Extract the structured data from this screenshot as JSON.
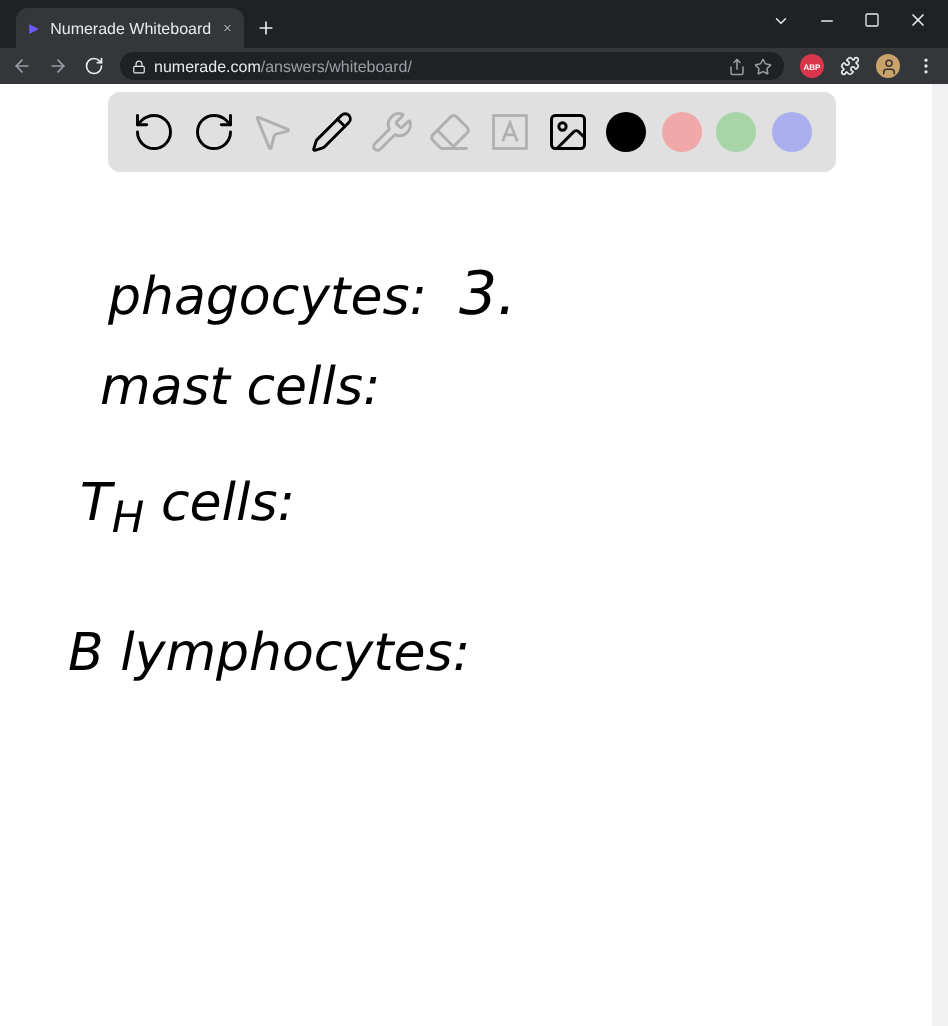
{
  "browser": {
    "tab": {
      "title": "Numerade Whiteboard",
      "selected": true
    },
    "address": {
      "domain": "numerade.com",
      "path": "/answers/whiteboard/"
    },
    "extension_badge": "ABP"
  },
  "toolbar": {
    "tools": [
      {
        "kind": "undo",
        "disabled": false
      },
      {
        "kind": "redo",
        "disabled": false
      },
      {
        "kind": "select",
        "disabled": true
      },
      {
        "kind": "pen",
        "disabled": false
      },
      {
        "kind": "shapes",
        "disabled": true
      },
      {
        "kind": "eraser",
        "disabled": true
      },
      {
        "kind": "text",
        "disabled": true
      },
      {
        "kind": "image",
        "disabled": false
      }
    ],
    "colors": [
      {
        "color": "#000000"
      },
      {
        "color": "#f0a8a8"
      },
      {
        "color": "#a8d4a8"
      },
      {
        "color": "#aab0ee"
      }
    ]
  },
  "whiteboard": {
    "lines": [
      {
        "label": "phagocytes:",
        "answer": "3."
      },
      {
        "label": "mast cells:"
      },
      {
        "label": "T$_{H}$ cells:"
      },
      {
        "label": "B lymphocytes:"
      }
    ]
  }
}
